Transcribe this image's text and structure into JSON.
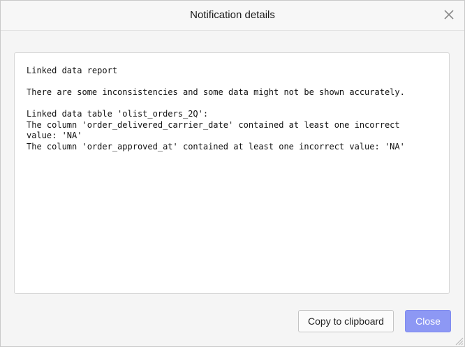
{
  "dialog": {
    "title": "Notification details"
  },
  "report": {
    "lines": [
      "Linked data report",
      "",
      "There are some inconsistencies and some data might not be shown accurately.",
      "",
      "Linked data table 'olist_orders_2Q':",
      "The column 'order_delivered_carrier_date' contained at least one incorrect",
      "value: 'NA'",
      "The column 'order_approved_at' contained at least one incorrect value: 'NA'"
    ]
  },
  "buttons": {
    "copy_label": "Copy to clipboard",
    "close_label": "Close"
  },
  "icons": {
    "close": "close-icon",
    "resize": "resize-grip-icon"
  },
  "colors": {
    "primary_button": "#8d98f4",
    "dialog_background": "#f5f5f5"
  }
}
